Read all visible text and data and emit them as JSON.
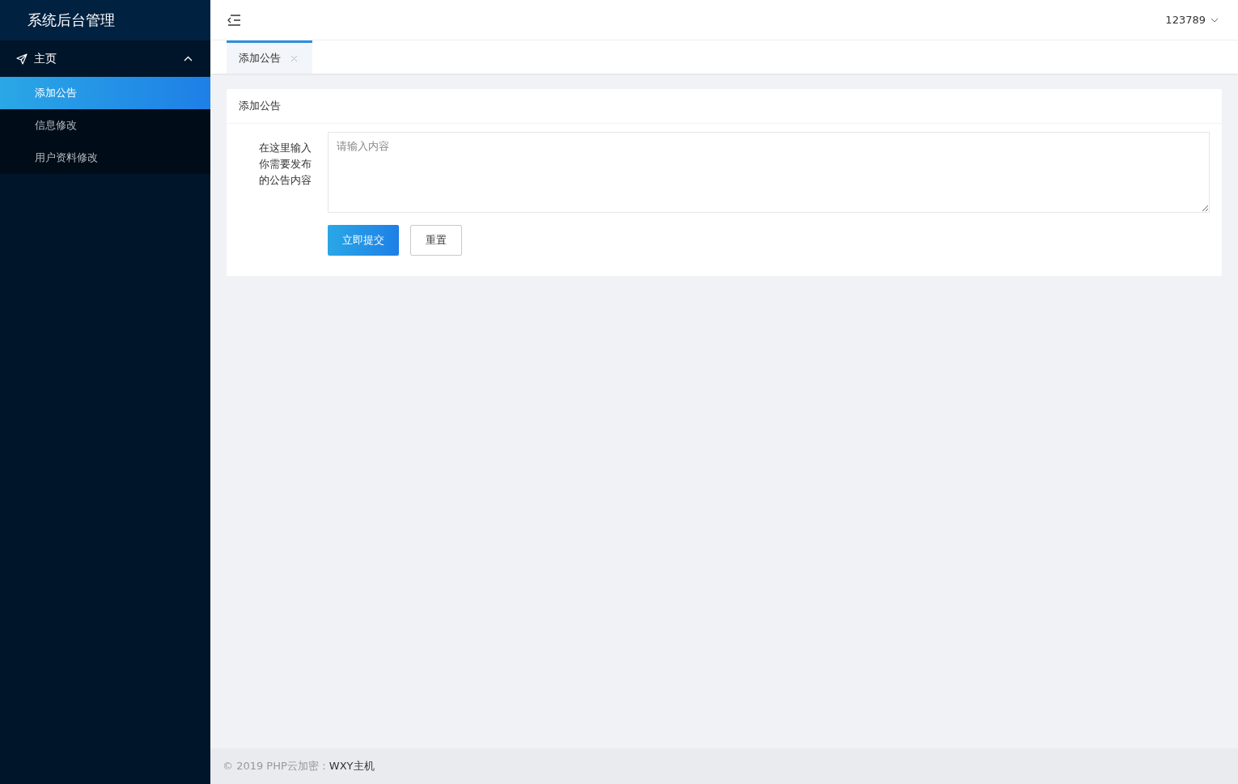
{
  "sidebar": {
    "logo": "系统后台管理",
    "groups": [
      {
        "label": "主页",
        "expanded": true,
        "children": [
          {
            "label": "添加公告",
            "selected": true
          },
          {
            "label": "信息修改",
            "selected": false
          },
          {
            "label": "用户资料修改",
            "selected": false
          }
        ]
      }
    ]
  },
  "header": {
    "user": "123789"
  },
  "tabs": [
    {
      "label": "添加公告",
      "selected": true
    }
  ],
  "card": {
    "title": "添加公告",
    "field_label": "在这里输入你需要发布的公告内容",
    "placeholder": "请输入内容",
    "buttons": [
      {
        "label": "立即提交",
        "kind": "primary"
      },
      {
        "label": "重置",
        "kind": "default"
      }
    ]
  },
  "footer": {
    "text": "© 2019 PHP云加密：",
    "link": "WXY主机"
  }
}
